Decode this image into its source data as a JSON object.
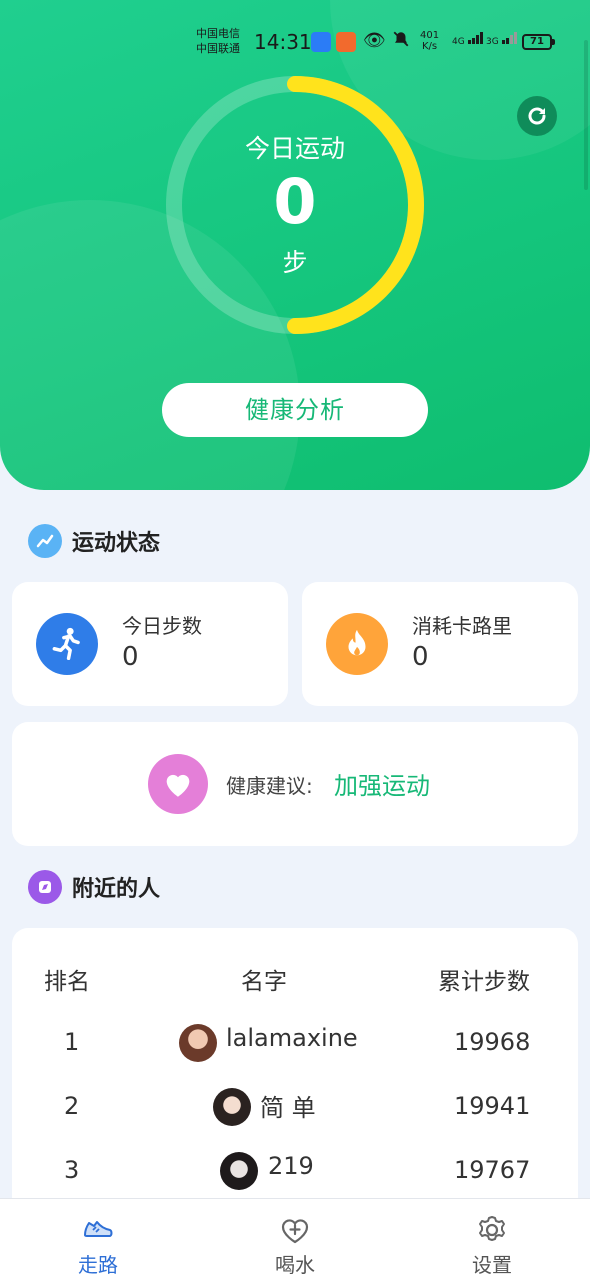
{
  "status_bar": {
    "carrier_1": "中国电信",
    "carrier_2": "中国联通",
    "time": "14:31",
    "speed_value": "401",
    "speed_unit": "K/s",
    "net_1": "4G",
    "net_2": "3G",
    "battery": "71"
  },
  "ring": {
    "title": "今日运动",
    "steps": "0",
    "unit": "步",
    "progress": 0.5
  },
  "analysis_button": "健康分析",
  "sections": {
    "exercise_status": "运动状态",
    "nearby_people": "附近的人"
  },
  "stats": {
    "steps_label": "今日步数",
    "steps_value": "0",
    "calories_label": "消耗卡路里",
    "calories_value": "0"
  },
  "advice": {
    "label": "健康建议:",
    "value": "加强运动"
  },
  "ranking": {
    "headers": [
      "排名",
      "名字",
      "累计步数"
    ],
    "rows": [
      {
        "rank": "1",
        "name": "lalamaxine",
        "steps": "19968"
      },
      {
        "rank": "2",
        "name": "简 单",
        "steps": "19941"
      },
      {
        "rank": "3",
        "name": "219",
        "steps": "19767"
      }
    ]
  },
  "nav": {
    "items": [
      {
        "label": "走路",
        "icon": "shoe-icon"
      },
      {
        "label": "喝水",
        "icon": "heart-plus-icon"
      },
      {
        "label": "设置",
        "icon": "gear-icon"
      }
    ],
    "active_index": 0
  },
  "colors": {
    "primary_green": "#17b877",
    "ring_yellow": "#ffe31c",
    "nav_active": "#2e6fd6"
  }
}
